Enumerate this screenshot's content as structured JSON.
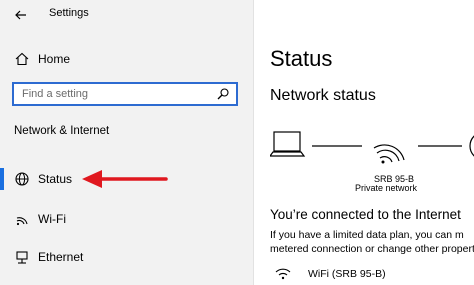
{
  "window": {
    "title": "Settings"
  },
  "sidebar": {
    "home_label": "Home",
    "search_placeholder": "Find a setting",
    "section_label": "Network & Internet",
    "items": [
      {
        "label": "Status",
        "icon": "globe-icon",
        "selected": true
      },
      {
        "label": "Wi-Fi",
        "icon": "wifi-icon",
        "selected": false
      },
      {
        "label": "Ethernet",
        "icon": "ethernet-icon",
        "selected": false
      }
    ]
  },
  "main": {
    "title": "Status",
    "subtitle": "Network status",
    "network_name": "SRB 95-B",
    "network_type": "Private network",
    "connected_text": "You’re connected to the Internet",
    "info_line1": "If you have a limited data plan, you can m",
    "info_line2": "metered connection or change other propert",
    "wifi_entry": "WiFi (SRB 95-B)"
  },
  "colors": {
    "accent": "#1a6fe0",
    "search_border": "#2d6bd1",
    "annotation_arrow": "#e0181f",
    "sidebar_bg": "#f2f2f2"
  }
}
